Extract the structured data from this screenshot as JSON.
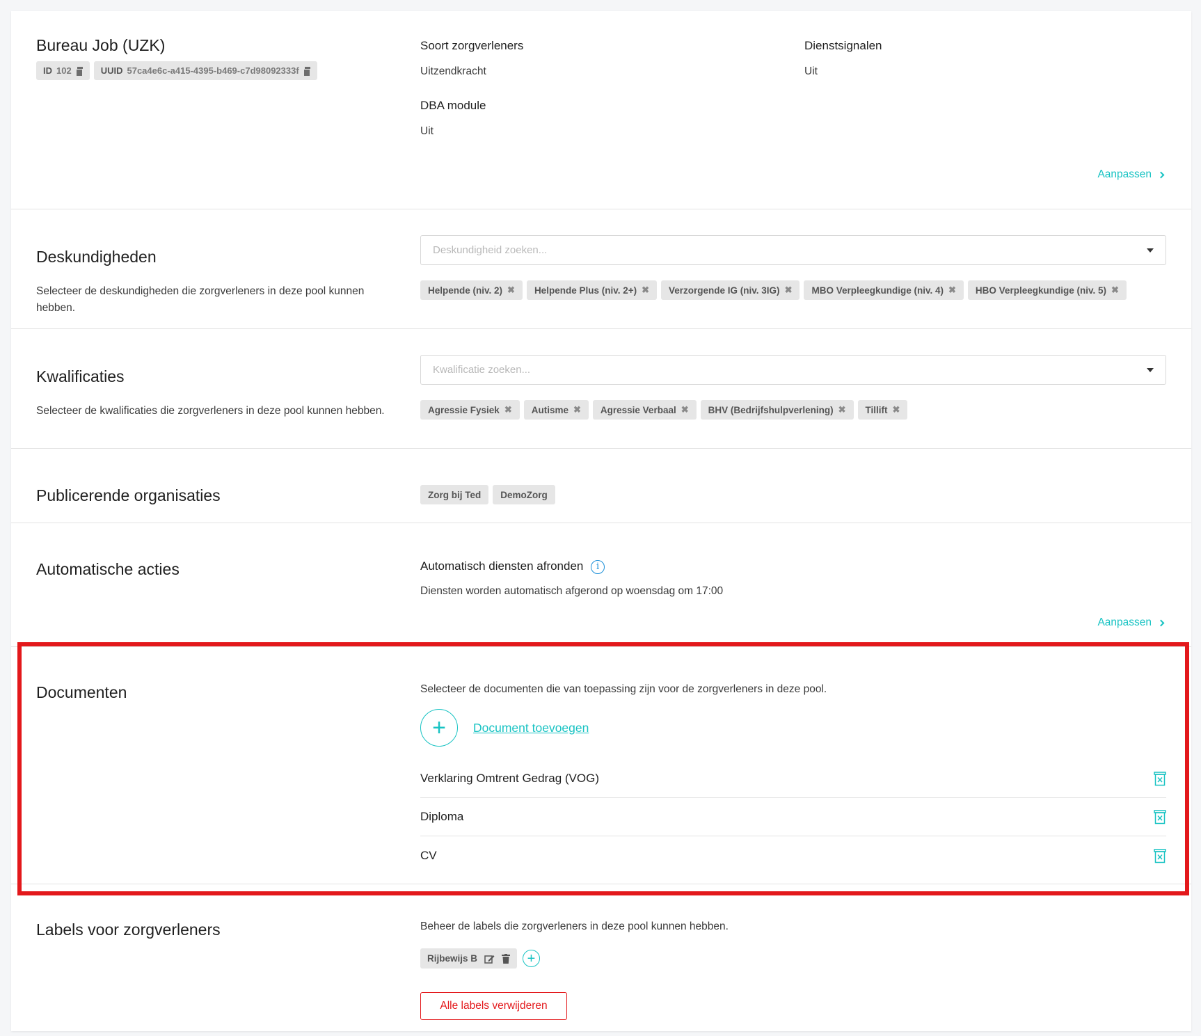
{
  "header": {
    "title": "Bureau Job (UZK)",
    "id_label": "ID",
    "id_value": "102",
    "uuid_label": "UUID",
    "uuid_value": "57ca4e6c-a415-4395-b469-c7d98092333f",
    "soort_label": "Soort zorgverleners",
    "soort_value": "Uitzendkracht",
    "dienst_label": "Dienstsignalen",
    "dienst_value": "Uit",
    "dba_label": "DBA module",
    "dba_value": "Uit",
    "edit_label": "Aanpassen"
  },
  "deskundigheden": {
    "title": "Deskundigheden",
    "description": "Selecteer de deskundigheden die zorgverleners in deze pool kunnen hebben.",
    "placeholder": "Deskundigheid zoeken...",
    "chips": [
      "Helpende (niv. 2)",
      "Helpende Plus (niv. 2+)",
      "Verzorgende IG (niv. 3IG)",
      "MBO Verpleegkundige (niv. 4)",
      "HBO Verpleegkundige (niv. 5)"
    ]
  },
  "kwalificaties": {
    "title": "Kwalificaties",
    "description": "Selecteer de kwalificaties die zorgverleners in deze pool kunnen hebben.",
    "placeholder": "Kwalificatie zoeken...",
    "chips": [
      "Agressie Fysiek",
      "Autisme",
      "Agressie Verbaal",
      "BHV (Bedrijfshulpverlening)",
      "Tillift"
    ]
  },
  "publicerende": {
    "title": "Publicerende organisaties",
    "chips": [
      "Zorg bij Ted",
      "DemoZorg"
    ]
  },
  "automatische": {
    "title": "Automatische acties",
    "label": "Automatisch diensten afronden",
    "value": "Diensten worden automatisch afgerond op woensdag om 17:00",
    "edit_label": "Aanpassen"
  },
  "documenten": {
    "title": "Documenten",
    "description": "Selecteer de documenten die van toepassing zijn voor de zorgverleners in deze pool.",
    "add_label": "Document toevoegen",
    "items": [
      "Verklaring Omtrent Gedrag (VOG)",
      "Diploma",
      "CV"
    ]
  },
  "labels": {
    "title": "Labels voor zorgverleners",
    "description": "Beheer de labels die zorgverleners in deze pool kunnen hebben.",
    "chip": "Rijbewijs B",
    "delete_all_label": "Alle labels verwijderen"
  },
  "colors": {
    "accent": "#18c3c3",
    "danger": "#e3181b",
    "info": "#1b8fd8"
  }
}
